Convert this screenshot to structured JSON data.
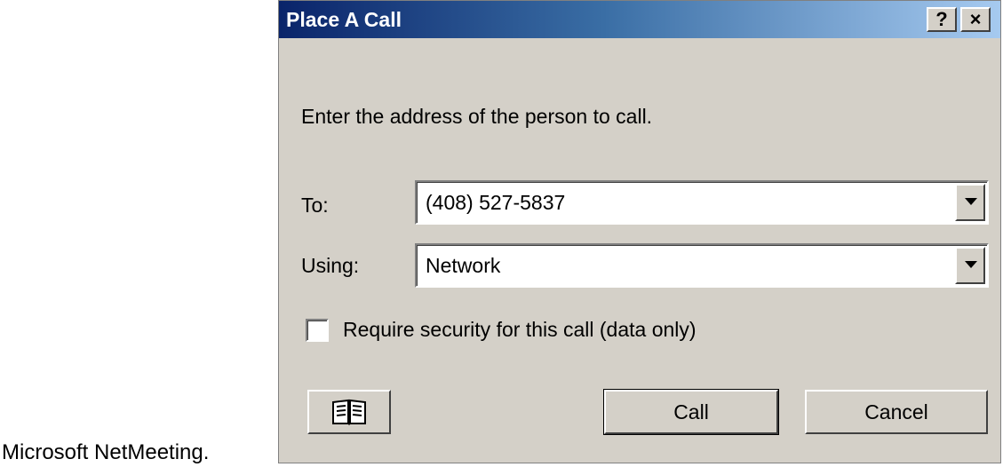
{
  "caption": "Microsoft NetMeeting.",
  "dialog": {
    "title": "Place A Call",
    "help_label": "?",
    "close_label": "×",
    "prompt": "Enter the address of the person to call.",
    "to_label": "To:",
    "to_value": "(408) 527-5837",
    "using_label": "Using:",
    "using_value": "Network",
    "security_label": "Require security for this call (data only)",
    "security_checked": false,
    "call_label": "Call",
    "cancel_label": "Cancel",
    "address_book_icon": "address-book-icon"
  }
}
